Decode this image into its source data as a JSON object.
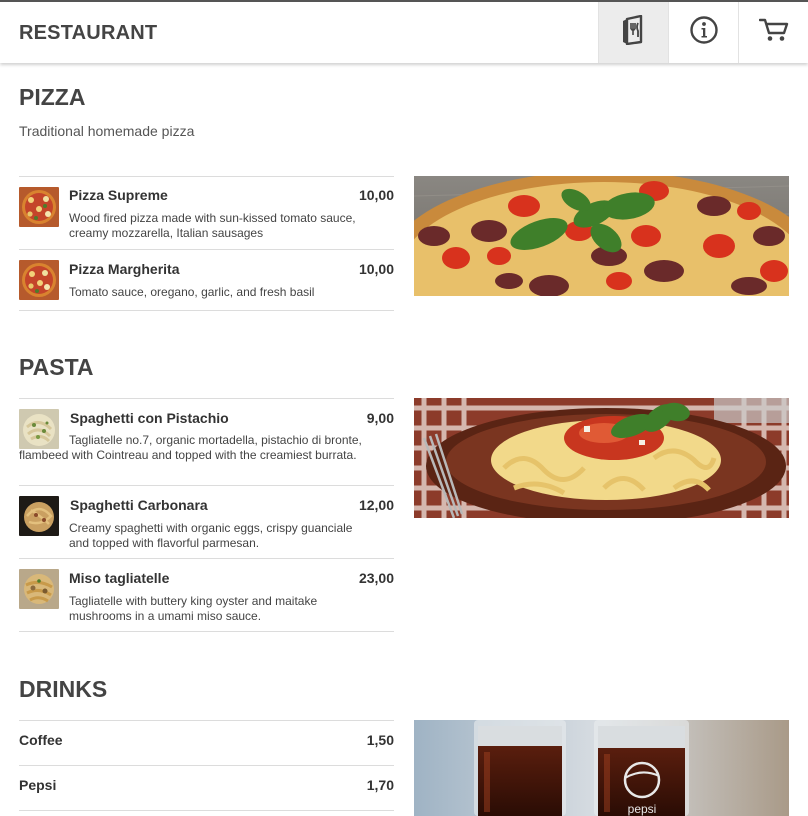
{
  "header": {
    "brand": "RESTAURANT",
    "nav": [
      {
        "name": "menu-icon",
        "active": true
      },
      {
        "name": "info-icon",
        "active": false
      },
      {
        "name": "cart-icon",
        "active": false
      }
    ]
  },
  "sections": [
    {
      "title": "PIZZA",
      "subtitle": "Traditional homemade pizza",
      "image": "pizza-photo",
      "items": [
        {
          "name": "Pizza Supreme",
          "price": "10,00",
          "description": "Wood fired pizza made with sun-kissed tomato sauce, creamy mozzarella, Italian sausages",
          "thumb": "pizza-thumb"
        },
        {
          "name": "Pizza Margherita",
          "price": "10,00",
          "description": "Tomato sauce, oregano, garlic, and fresh basil",
          "thumb": "pizza-thumb"
        }
      ]
    },
    {
      "title": "PASTA",
      "image": "pasta-photo",
      "items": [
        {
          "name": "Spaghetti con Pistachio",
          "price": "9,00",
          "description": "Tagliatelle no.7, organic mortadella, pistachio di bronte, flambeed with Cointreau and topped with the creamiest burrata.",
          "thumb": "pesto-thumb"
        },
        {
          "name": "Spaghetti Carbonara",
          "price": "12,00",
          "description": "Creamy spaghetti with organic eggs, crispy guanciale and topped with flavorful parmesan.",
          "thumb": "carbonara-thumb"
        },
        {
          "name": "Miso tagliatelle",
          "price": "23,00",
          "description": "Tagliatelle with buttery king oyster and maitake mushrooms in a umami miso sauce.",
          "thumb": "miso-thumb"
        }
      ]
    },
    {
      "title": "DRINKS",
      "image": "cola-photo",
      "items": [
        {
          "name": "Coffee",
          "price": "1,50"
        },
        {
          "name": "Pepsi",
          "price": "1,70"
        }
      ]
    }
  ],
  "photo_brand_text": "pepsi",
  "colors": {
    "text": "#444444",
    "divider": "#dcdcdc",
    "active_nav": "#ececec",
    "header_border": "#555555"
  }
}
